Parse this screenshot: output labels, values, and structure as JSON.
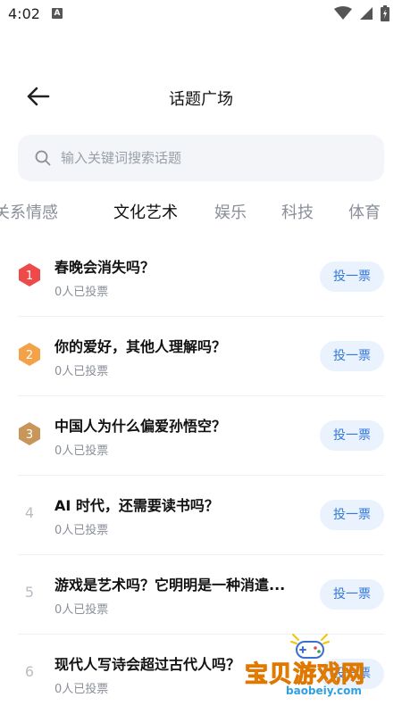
{
  "status_bar": {
    "time": "4:02",
    "notification_icon": "A"
  },
  "header": {
    "title": "话题广场"
  },
  "search": {
    "placeholder": "输入关键词搜索话题"
  },
  "tabs": [
    {
      "label": "关系情感",
      "active": false
    },
    {
      "label": "文化艺术",
      "active": true
    },
    {
      "label": "娱乐",
      "active": false
    },
    {
      "label": "科技",
      "active": false
    },
    {
      "label": "体育",
      "active": false
    }
  ],
  "topics": [
    {
      "rank": "1",
      "title": "春晚会消失吗？",
      "votes": "0人已投票",
      "button": "投一票"
    },
    {
      "rank": "2",
      "title": "你的爱好，其他人理解吗？",
      "votes": "0人已投票",
      "button": "投一票"
    },
    {
      "rank": "3",
      "title": "中国人为什么偏爱孙悟空？",
      "votes": "0人已投票",
      "button": "投一票"
    },
    {
      "rank": "4",
      "title": "AI 时代，还需要读书吗？",
      "votes": "0人已投票",
      "button": "投一票"
    },
    {
      "rank": "5",
      "title": "游戏是艺术吗？它明明是一种消遣...",
      "votes": "0人已投票",
      "button": "投一票"
    },
    {
      "rank": "6",
      "title": "现代人写诗会超过古代人吗？",
      "votes": "0人已投票",
      "button": "投一票"
    }
  ],
  "rank_colors": {
    "1": "#ee4a4a",
    "2": "#f3a24a",
    "3": "#c9965a"
  },
  "watermark": {
    "text": "宝贝游戏网",
    "url": "baobeiy.com"
  }
}
